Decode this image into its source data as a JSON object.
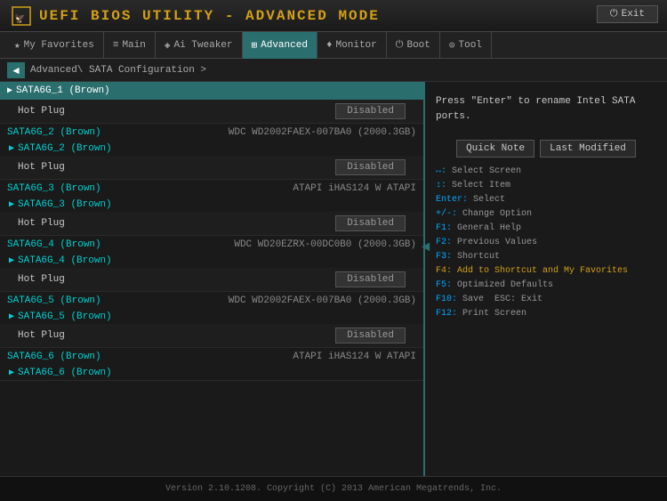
{
  "header": {
    "title": "UEFI BIOS UTILITY - ADVANCED MODE",
    "exit_label": "Exit"
  },
  "navbar": {
    "items": [
      {
        "id": "favorites",
        "icon": "★",
        "label": "My Favorites"
      },
      {
        "id": "main",
        "icon": "≡",
        "label": "Main"
      },
      {
        "id": "ai_tweaker",
        "icon": "◈",
        "label": "Ai Tweaker"
      },
      {
        "id": "advanced",
        "icon": "⊞",
        "label": "Advanced",
        "active": true
      },
      {
        "id": "monitor",
        "icon": "♦",
        "label": "Monitor"
      },
      {
        "id": "boot",
        "icon": "⏻",
        "label": "Boot"
      },
      {
        "id": "tool",
        "icon": "⊙",
        "label": "Tool"
      }
    ]
  },
  "breadcrumb": {
    "text": "Advanced\\ SATA Configuration >"
  },
  "sata_ports": [
    {
      "id": "SATA6G_1",
      "label": "SATA6G_1 (Brown)",
      "selected": true,
      "drive": "",
      "sub_label": "SATA6G_1 (Brown)",
      "hot_plug": "Hot Plug",
      "hot_plug_value": "Disabled"
    },
    {
      "id": "SATA6G_2",
      "label": "SATA6G_2 (Brown)",
      "selected": false,
      "drive": "WDC WD2002FAEX-007BA0 (2000.3GB)",
      "sub_label": "SATA6G_2 (Brown)",
      "hot_plug": "Hot Plug",
      "hot_plug_value": "Disabled"
    },
    {
      "id": "SATA6G_3",
      "label": "SATA6G_3 (Brown)",
      "selected": false,
      "drive": "ATAPI   iHAS124   W ATAPI",
      "sub_label": "SATA6G_3 (Brown)",
      "hot_plug": "Hot Plug",
      "hot_plug_value": "Disabled"
    },
    {
      "id": "SATA6G_4",
      "label": "SATA6G_4 (Brown)",
      "selected": false,
      "drive": "WDC WD20EZRX-00DC0B0 (2000.3GB)",
      "sub_label": "SATA6G_4 (Brown)",
      "hot_plug": "Hot Plug",
      "hot_plug_value": "Disabled"
    },
    {
      "id": "SATA6G_5",
      "label": "SATA6G_5 (Brown)",
      "selected": false,
      "drive": "WDC WD2002FAEX-007BA0 (2000.3GB)",
      "sub_label": "SATA6G_5 (Brown)",
      "hot_plug": "Hot Plug",
      "hot_plug_value": "Disabled"
    },
    {
      "id": "SATA6G_6",
      "label": "SATA6G_6 (Brown)",
      "selected": false,
      "drive": "ATAPI   iHAS124   W ATAPI",
      "sub_label": "SATA6G_6 (Brown)",
      "hot_plug": null,
      "hot_plug_value": null
    }
  ],
  "right_panel": {
    "help_text": "Press \"Enter\" to rename Intel SATA ports.",
    "quick_note_label": "Quick Note",
    "last_modified_label": "Last Modified",
    "shortcuts": [
      {
        "keys": "↔:",
        "desc": "Select Screen"
      },
      {
        "keys": "↕:",
        "desc": "Select Item"
      },
      {
        "keys": "Enter:",
        "desc": "Select"
      },
      {
        "keys": "+/-:",
        "desc": "Change Option"
      },
      {
        "keys": "F1:",
        "desc": "General Help"
      },
      {
        "keys": "F2:",
        "desc": "Previous Values"
      },
      {
        "keys": "F3:",
        "desc": "Shortcut"
      },
      {
        "keys": "F4:",
        "desc": "Add to Shortcut and My Favorites",
        "highlight": "f4"
      },
      {
        "keys": "F5:",
        "desc": "Optimized Defaults"
      },
      {
        "keys": "F10:",
        "desc": "Save  ESC: Exit"
      },
      {
        "keys": "F12:",
        "desc": "Print Screen"
      }
    ]
  },
  "footer": {
    "text": "Version 2.10.1208. Copyright (C) 2013 American Megatrends, Inc."
  }
}
